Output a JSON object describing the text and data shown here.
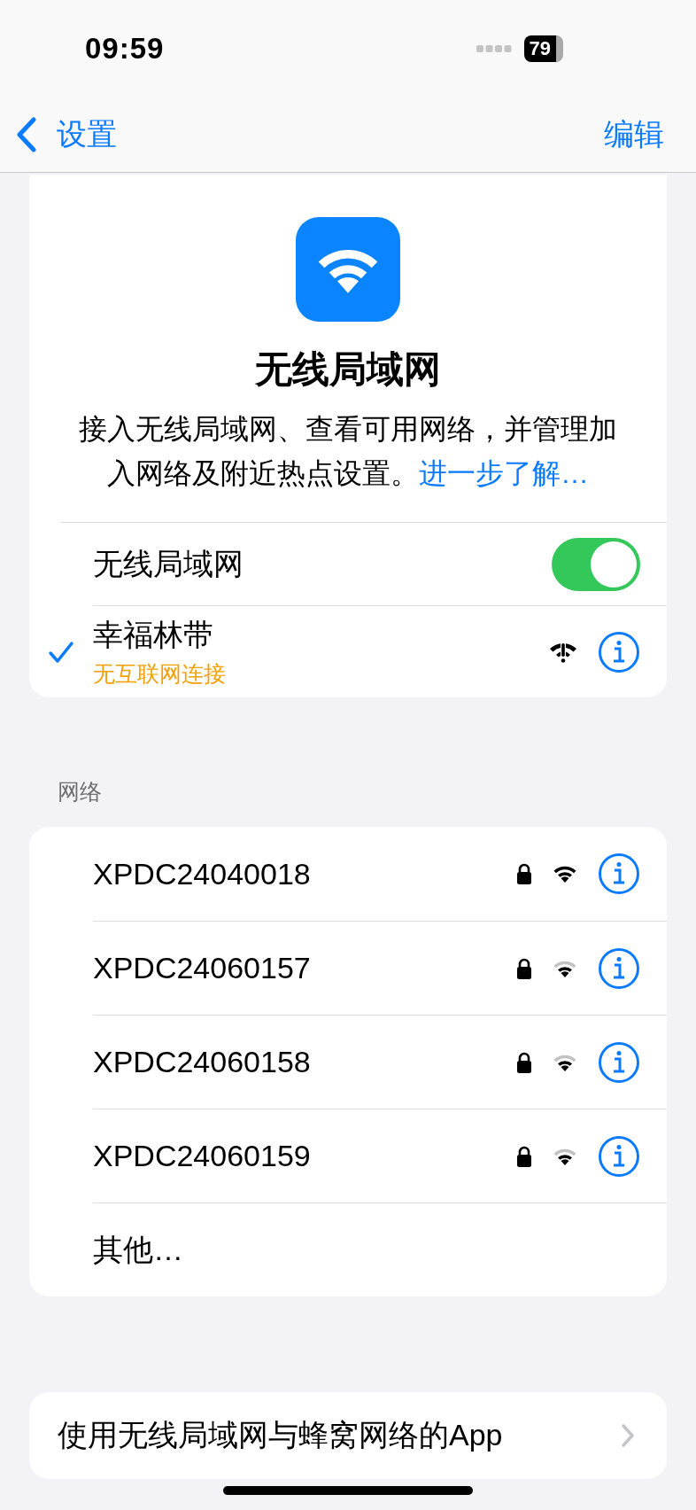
{
  "status_bar": {
    "time": "09:59",
    "battery": "79"
  },
  "nav": {
    "back": "设置",
    "action": "编辑"
  },
  "header": {
    "title": "无线局域网",
    "description": "接入无线局域网、查看可用网络，并管理加入网络及附近热点设置。",
    "link": "进一步了解…"
  },
  "wifi_toggle": {
    "label": "无线局域网",
    "on": true
  },
  "current_network": {
    "name": "幸福林带",
    "status": "无互联网连接",
    "selected": true,
    "kind": "warning"
  },
  "networks_header": "网络",
  "networks": [
    {
      "name": "XPDC24040018",
      "locked": true,
      "kind": "strong"
    },
    {
      "name": "XPDC24060157",
      "locked": true,
      "kind": "medium"
    },
    {
      "name": "XPDC24060158",
      "locked": true,
      "kind": "medium"
    },
    {
      "name": "XPDC24060159",
      "locked": true,
      "kind": "medium"
    }
  ],
  "other": "其他…",
  "apps_row": {
    "label": "使用无线局域网与蜂窝网络的App"
  }
}
